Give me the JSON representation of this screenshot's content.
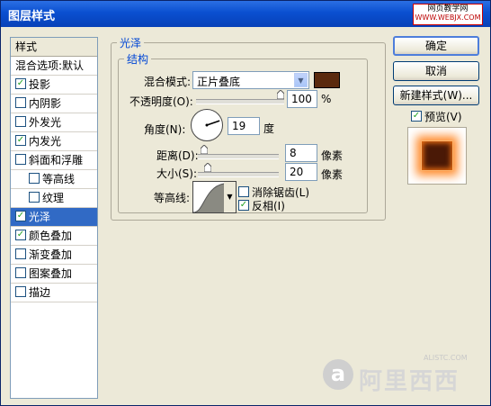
{
  "window": {
    "title": "图层样式"
  },
  "watermark_top": {
    "line1": "网页教学网",
    "line2": "WWW.WEBJX.COM"
  },
  "style_list": {
    "header": "样式",
    "blending": "混合选项:默认",
    "items": [
      {
        "label": "投影",
        "checked": true,
        "indent": false,
        "selected": false
      },
      {
        "label": "内阴影",
        "checked": false,
        "indent": false,
        "selected": false
      },
      {
        "label": "外发光",
        "checked": false,
        "indent": false,
        "selected": false
      },
      {
        "label": "内发光",
        "checked": true,
        "indent": false,
        "selected": false
      },
      {
        "label": "斜面和浮雕",
        "checked": false,
        "indent": false,
        "selected": false
      },
      {
        "label": "等高线",
        "checked": false,
        "indent": true,
        "selected": false
      },
      {
        "label": "纹理",
        "checked": false,
        "indent": true,
        "selected": false
      },
      {
        "label": "光泽",
        "checked": true,
        "indent": false,
        "selected": true
      },
      {
        "label": "颜色叠加",
        "checked": true,
        "indent": false,
        "selected": false
      },
      {
        "label": "渐变叠加",
        "checked": false,
        "indent": false,
        "selected": false
      },
      {
        "label": "图案叠加",
        "checked": false,
        "indent": false,
        "selected": false
      },
      {
        "label": "描边",
        "checked": false,
        "indent": false,
        "selected": false
      }
    ]
  },
  "satin": {
    "section_title": "光泽",
    "structure_title": "结构",
    "blend_mode_label": "混合模式:",
    "blend_mode_value": "正片叠底",
    "color": "#5b2a0e",
    "opacity_label": "不透明度(O):",
    "opacity_value": "100",
    "opacity_unit": "%",
    "opacity_level": 100,
    "angle_label": "角度(N):",
    "angle_value": "19",
    "angle_unit": "度",
    "distance_label": "距离(D):",
    "distance_value": "8",
    "distance_unit": "像素",
    "distance_level": 8,
    "size_label": "大小(S):",
    "size_value": "20",
    "size_unit": "像素",
    "size_level": 20,
    "contour_label": "等高线:",
    "anti_alias_label": "消除锯齿(L)",
    "anti_alias_checked": false,
    "invert_label": "反相(I)",
    "invert_checked": true
  },
  "buttons": {
    "ok": "确定",
    "cancel": "取消",
    "new_style": "新建样式(W)..."
  },
  "preview": {
    "label": "预览(V)",
    "checked": true
  },
  "watermark_bottom": {
    "text": "阿里西西",
    "small": "ALISTC.COM"
  }
}
